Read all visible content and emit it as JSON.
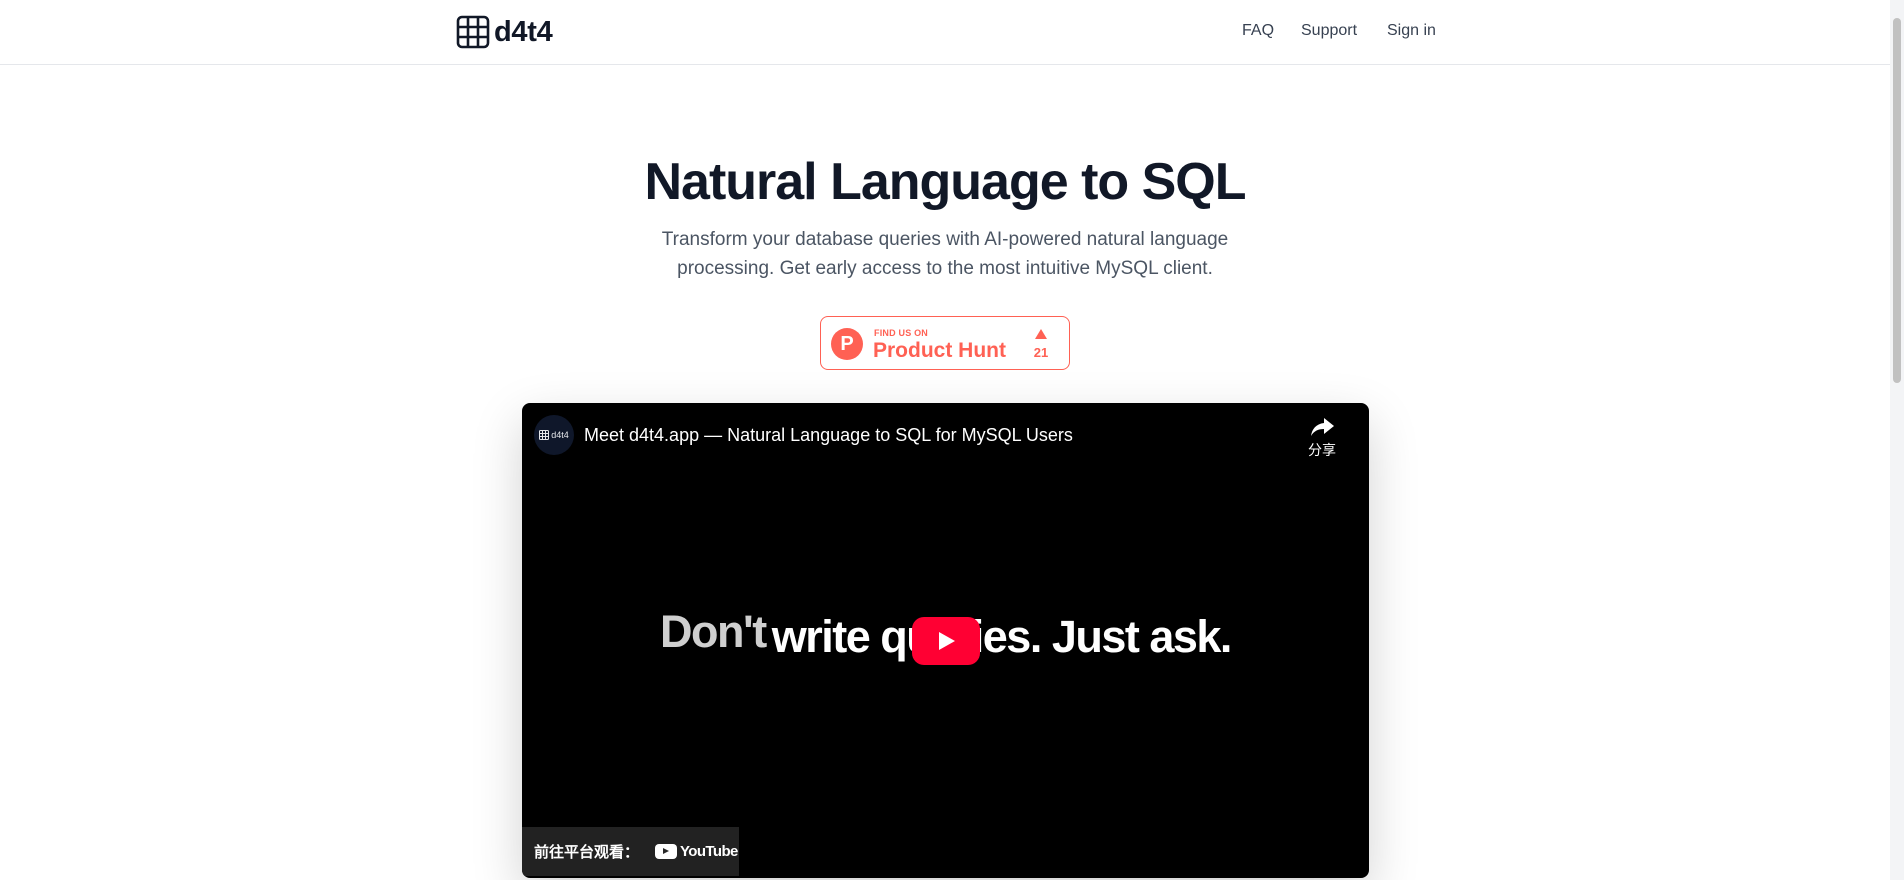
{
  "header": {
    "brand": "d4t4",
    "brand_icon": "grid-table-icon",
    "nav": {
      "faq": "FAQ",
      "support": "Support",
      "signin": "Sign in"
    }
  },
  "hero": {
    "title": "Natural Language to SQL",
    "subtitle": "Transform your database queries with AI-powered natural language processing. Get early access to the most intuitive MySQL client."
  },
  "product_hunt": {
    "kicker": "FIND US ON",
    "name": "Product Hunt",
    "logo_letter": "P",
    "upvotes": "21",
    "color": "#ff6154"
  },
  "video": {
    "channel_avatar_text": "d4t4",
    "title": "Meet d4t4.app — Natural Language to SQL for MySQL Users",
    "share_label": "分享",
    "frame_text_dim": "Don't",
    "frame_text_main": "write queries. Just ask.",
    "watch_on_label": "前往平台观看：",
    "youtube_word": "YouTube",
    "play_color": "#ff0033"
  }
}
